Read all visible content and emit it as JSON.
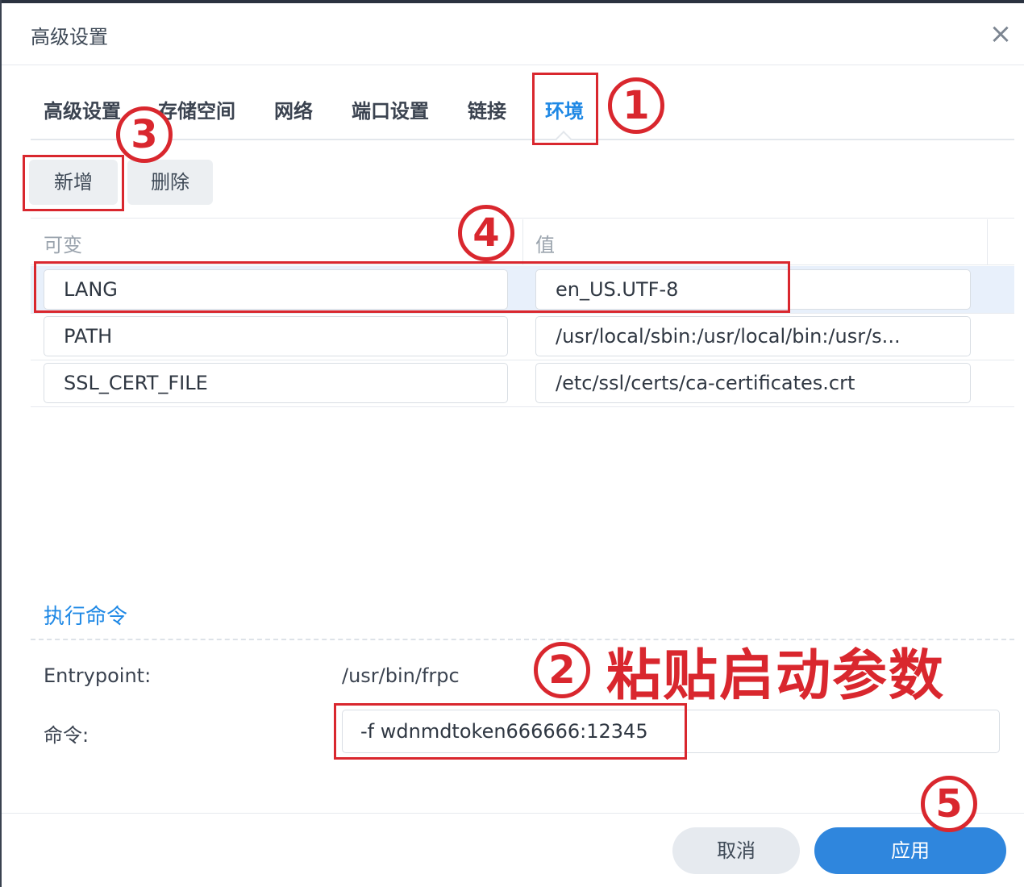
{
  "dialog": {
    "title": "高级设置",
    "close_glyph": "×"
  },
  "tabs": [
    {
      "label": "高级设置"
    },
    {
      "label": "存储空间"
    },
    {
      "label": "网络"
    },
    {
      "label": "端口设置"
    },
    {
      "label": "链接"
    },
    {
      "label": "环境",
      "active": true
    }
  ],
  "toolbar": {
    "add_label": "新增",
    "delete_label": "删除"
  },
  "env_table": {
    "headers": {
      "key": "可变",
      "value": "值"
    },
    "rows": [
      {
        "key": "LANG",
        "value": "en_US.UTF-8",
        "selected": true
      },
      {
        "key": "PATH",
        "value": "/usr/local/sbin:/usr/local/bin:/usr/s..."
      },
      {
        "key": "SSL_CERT_FILE",
        "value": "/etc/ssl/certs/ca-certificates.crt"
      }
    ]
  },
  "exec": {
    "section_title": "执行命令",
    "entrypoint_label": "Entrypoint:",
    "entrypoint_value": "/usr/bin/frpc",
    "command_label": "命令:",
    "command_value": "-f wdnmdtoken666666:12345"
  },
  "footer": {
    "cancel_label": "取消",
    "apply_label": "应用"
  },
  "annotations": {
    "step1": "1",
    "step2": "2",
    "step3": "3",
    "step4": "4",
    "step5": "5",
    "step2_text": "粘贴启动参数",
    "color": "#d9272e"
  },
  "colors": {
    "accent": "#1e88e5",
    "apply_button": "#2f86dd"
  }
}
